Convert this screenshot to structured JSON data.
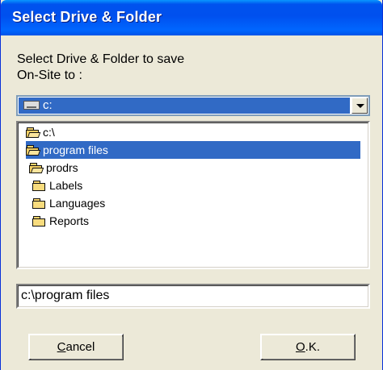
{
  "window": {
    "title": "Select Drive & Folder"
  },
  "prompt": {
    "line1": "Select Drive & Folder to save",
    "line2": "On-Site to :"
  },
  "drive": {
    "selected": "c:"
  },
  "tree": {
    "items": [
      {
        "label": "c:\\",
        "icon": "open-folder-icon"
      },
      {
        "label": "program files",
        "icon": "open-folder-icon",
        "selected": true
      },
      {
        "label": "prodrs",
        "icon": "open-folder-icon"
      },
      {
        "label": "Labels",
        "icon": "folder-icon"
      },
      {
        "label": "Languages",
        "icon": "folder-icon"
      },
      {
        "label": "Reports",
        "icon": "folder-icon"
      }
    ]
  },
  "path": {
    "value": "c:\\program files"
  },
  "buttons": {
    "cancel": {
      "mnemonic": "C",
      "rest": "ancel"
    },
    "ok": {
      "mnemonic": "O",
      "rest": ".K."
    }
  },
  "colors": {
    "titlebar": "#0053ee",
    "selection": "#316ac5",
    "face": "#ece9d8"
  }
}
